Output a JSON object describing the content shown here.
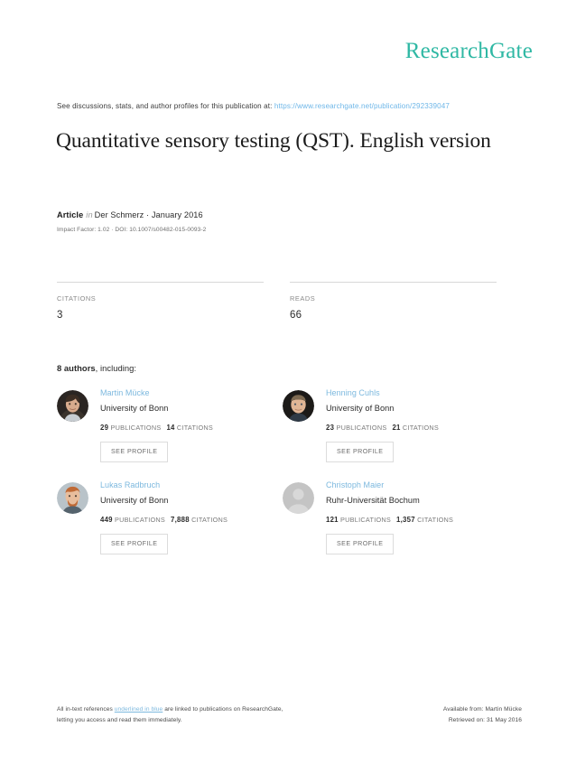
{
  "brand": {
    "name": "ResearchGate",
    "color": "#2fb8a4"
  },
  "lead": {
    "text": "See discussions, stats, and author profiles for this publication at:",
    "url": "https://www.researchgate.net/publication/292339047",
    "url_color": "#6fb7e8"
  },
  "publication": {
    "title": "Quantitative sensory testing (QST). English version",
    "kind": "Article",
    "in_word": "in",
    "venue_date": "Der Schmerz · January 2016",
    "impact_doi": "Impact Factor: 1.02 · DOI: 10.1007/s00482-015-0093-2"
  },
  "stats": [
    {
      "label": "CITATIONS",
      "value": "3"
    },
    {
      "label": "READS",
      "value": "66"
    }
  ],
  "authors_header": {
    "count": "8",
    "word": "authors",
    "suffix": ", including:"
  },
  "see_profile_label": "SEE PROFILE",
  "metrics_labels": {
    "publications": "PUBLICATIONS",
    "citations": "CITATIONS"
  },
  "authors": [
    {
      "name": "Martin Mücke",
      "affiliation": "University of Bonn",
      "publications": "29",
      "citations": "14",
      "avatar_type": "photo",
      "avatar_name": "avatar-martin-mucke"
    },
    {
      "name": "Henning Cuhls",
      "affiliation": "University of Bonn",
      "publications": "23",
      "citations": "21",
      "avatar_type": "photo",
      "avatar_name": "avatar-henning-cuhls"
    },
    {
      "name": "Lukas Radbruch",
      "affiliation": "University of Bonn",
      "publications": "449",
      "citations": "7,888",
      "avatar_type": "photo",
      "avatar_name": "avatar-lukas-radbruch"
    },
    {
      "name": "Christoph Maier",
      "affiliation": "Ruhr-Universität Bochum",
      "publications": "121",
      "citations": "1,357",
      "avatar_type": "placeholder",
      "avatar_name": "avatar-placeholder-icon"
    }
  ],
  "footer": {
    "left_part1": "All in-text references ",
    "left_link": "underlined in blue",
    "left_part2": " are linked to publications on ResearchGate,",
    "left_line2": "letting you access and read them immediately.",
    "right_line1": "Available from: Martin Mücke",
    "right_line2": "Retrieved on: 31 May 2016"
  }
}
